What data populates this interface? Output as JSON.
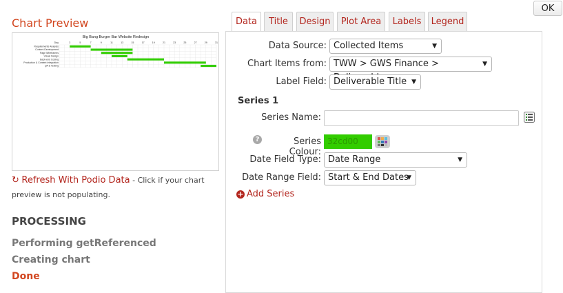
{
  "dialog": {
    "ok_label": "OK"
  },
  "preview": {
    "title": "Chart Preview",
    "refresh_link": "Refresh With Podio Data",
    "refresh_note": " - Click if your chart preview is not populating.",
    "refresh_icon": "refresh-icon"
  },
  "processing": {
    "heading": "PROCESSING",
    "steps": [
      {
        "label": "Performing getReferenced",
        "state": "complete"
      },
      {
        "label": "Creating chart",
        "state": "complete"
      },
      {
        "label": "Done",
        "state": "done"
      }
    ]
  },
  "tabs": [
    {
      "label": "Data",
      "active": true
    },
    {
      "label": "Title",
      "active": false
    },
    {
      "label": "Design",
      "active": false
    },
    {
      "label": "Plot Area",
      "active": false
    },
    {
      "label": "Labels",
      "active": false
    },
    {
      "label": "Legend",
      "active": false
    }
  ],
  "data_tab": {
    "data_source_label": "Data Source:",
    "data_source_value": "Collected Items",
    "chart_items_label": "Chart Items from:",
    "chart_items_value": "TWW > GWS Finance > Deliverables",
    "label_field_label": "Label Field:",
    "label_field_value": "Deliverable Title",
    "series_heading": "Series 1",
    "series_name_label": "Series Name:",
    "series_name_value": "",
    "series_colour_label": "Series Colour:",
    "series_colour_value": "32cd00",
    "date_field_type_label": "Date Field Type:",
    "date_field_type_value": "Date Range",
    "date_range_field_label": "Date Range Field:",
    "date_range_field_value": "Start & End Dates",
    "add_series_label": "Add Series"
  },
  "colors": {
    "accent": "#b3261e",
    "title": "#d2461f",
    "series": "#32cd00"
  },
  "chart_data": {
    "type": "bar",
    "title": "Big Bang Burger Bar Website Redesign",
    "x_ticks": [
      "Day",
      "3",
      "5",
      "7",
      "9",
      "11",
      "13",
      "15",
      "17",
      "19",
      "21",
      "23",
      "25",
      "27",
      "29",
      "31"
    ],
    "xlim": [
      1,
      31
    ],
    "categories": [
      "Requirements Analysis",
      "Content Development",
      "Page Wireframes",
      "Visual Design",
      "Back-end Coding",
      "Production & Content Integration",
      "QA & Testing"
    ],
    "series": [
      {
        "values": [
          [
            3,
            7
          ],
          [
            7,
            15
          ],
          [
            9,
            15
          ],
          [
            11,
            14
          ],
          [
            14,
            21
          ],
          [
            21,
            29
          ],
          [
            28,
            31
          ]
        ]
      }
    ]
  }
}
